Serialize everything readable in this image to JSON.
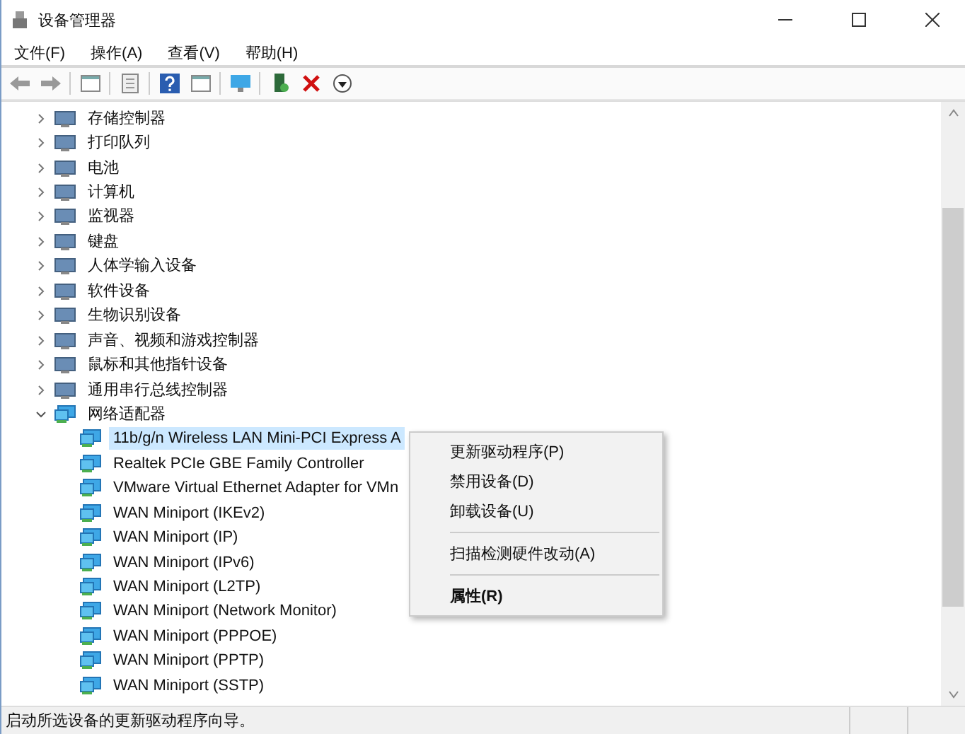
{
  "window": {
    "title": "设备管理器"
  },
  "menu": [
    "文件(F)",
    "操作(A)",
    "查看(V)",
    "帮助(H)"
  ],
  "tree": [
    {
      "label": "存储控制器",
      "expanded": false
    },
    {
      "label": "打印队列",
      "expanded": false
    },
    {
      "label": "电池",
      "expanded": false
    },
    {
      "label": "计算机",
      "expanded": false
    },
    {
      "label": "监视器",
      "expanded": false
    },
    {
      "label": "键盘",
      "expanded": false
    },
    {
      "label": "人体学输入设备",
      "expanded": false
    },
    {
      "label": "软件设备",
      "expanded": false
    },
    {
      "label": "生物识别设备",
      "expanded": false
    },
    {
      "label": "声音、视频和游戏控制器",
      "expanded": false
    },
    {
      "label": "鼠标和其他指针设备",
      "expanded": false
    },
    {
      "label": "通用串行总线控制器",
      "expanded": false
    },
    {
      "label": "网络适配器",
      "expanded": true,
      "children": [
        {
          "label": "11b/g/n  Wireless LAN Mini-PCI Express A",
          "selected": true
        },
        {
          "label": "Realtek PCIe GBE Family Controller",
          "selected": false
        },
        {
          "label": "VMware Virtual Ethernet Adapter for VMn",
          "selected": false
        },
        {
          "label": "WAN Miniport (IKEv2)",
          "selected": false
        },
        {
          "label": "WAN Miniport (IP)",
          "selected": false
        },
        {
          "label": "WAN Miniport (IPv6)",
          "selected": false
        },
        {
          "label": "WAN Miniport (L2TP)",
          "selected": false
        },
        {
          "label": "WAN Miniport (Network Monitor)",
          "selected": false
        },
        {
          "label": "WAN Miniport (PPPOE)",
          "selected": false
        },
        {
          "label": "WAN Miniport (PPTP)",
          "selected": false
        },
        {
          "label": "WAN Miniport (SSTP)",
          "selected": false
        }
      ]
    }
  ],
  "context_menu": [
    {
      "kind": "item",
      "label": "更新驱动程序(P)"
    },
    {
      "kind": "item",
      "label": "禁用设备(D)"
    },
    {
      "kind": "item",
      "label": "卸载设备(U)"
    },
    {
      "kind": "separator"
    },
    {
      "kind": "item",
      "label": "扫描检测硬件改动(A)"
    },
    {
      "kind": "separator"
    },
    {
      "kind": "bold",
      "label": "属性(R)"
    }
  ],
  "status_bar": "启动所选设备的更新驱动程序向导。"
}
